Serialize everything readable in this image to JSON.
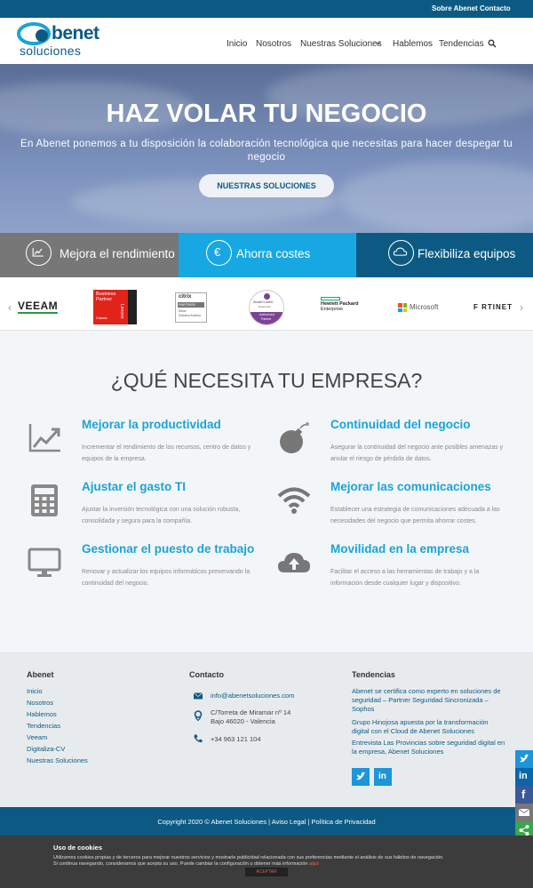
{
  "topbar": {
    "about": "Sobre Abenet",
    "contact": "Contacto"
  },
  "logo": {
    "name": "benet",
    "sub": "soluciones"
  },
  "nav": [
    {
      "label": "Inicio"
    },
    {
      "label": "Nosotros"
    },
    {
      "label": "Nuestras Soluciones"
    },
    {
      "label": "Hablemos"
    },
    {
      "label": "Tendencias"
    }
  ],
  "hero": {
    "title": "HAZ VOLAR TU NEGOCIO",
    "subtitle": "En Abenet ponemos a tu disposición la colaboración tecnológica que necesitas para hacer despegar tu negocio",
    "button": "NUESTRAS SOLUCIONES"
  },
  "features": [
    {
      "label": "Mejora el rendimiento",
      "color": "#777777"
    },
    {
      "label": "Ahorra costes",
      "color": "#17a8e3"
    },
    {
      "label": "Flexibiliza equipos",
      "color": "#0c5a83"
    }
  ],
  "partners": {
    "veeam": "VEEAM",
    "lenovo_line1": "Business",
    "lenovo_line2": "Partner",
    "lenovo_brand": "Lenovo",
    "lenovo_tier": "Classic",
    "citrix": "citrix",
    "citrix_line1": "PARTNER",
    "citrix_line2": "Silver",
    "citrix_line3": "Solution Advisor",
    "alcatel_name": "Alcatel·Lucent",
    "alcatel_sub": "Enterprise",
    "alcatel_tier1": "Authorized",
    "alcatel_tier2": "Partner",
    "hpe_line1": "Hewlett Packard",
    "hpe_line2": "Enterprise",
    "microsoft": "Microsoft",
    "fortinet": "F RTINET"
  },
  "section": {
    "title": "¿QUÉ NECESITA TU EMPRESA?"
  },
  "services": [
    {
      "title": "Mejorar la productividad",
      "text": "Incrementar el rendimiento de los recursos, centro de datos y equipos de la empresa.",
      "icon": "chart-line-icon"
    },
    {
      "title": "Continuidad del negocio",
      "text": "Asegurar la continuidad del negocio ante posibles amenazas y anular el riesgo de pérdida de datos.",
      "icon": "bomb-icon"
    },
    {
      "title": "Ajustar el gasto TI",
      "text": "Ajustar la inversión tecnológica con una solución robusta, consolidada y segura para la compañía.",
      "icon": "calculator-icon"
    },
    {
      "title": "Mejorar las comunicaciones",
      "text": "Establecer una estrategia de comunicaciones adecuada a las necesidades del negocio que permita ahorrar costes.",
      "icon": "wifi-icon"
    },
    {
      "title": "Gestionar el puesto de trabajo",
      "text": "Renovar y actualizar los equipos informáticos preservando la continuidad del negocio.",
      "icon": "monitor-icon"
    },
    {
      "title": "Movilidad en la empresa",
      "text": "Facilitar el acceso a las herramientas de trabajo y a la información desde cualquier lugar y dispositivo.",
      "icon": "cloud-upload-icon"
    }
  ],
  "footer": {
    "col1": {
      "title": "Abenet",
      "links": [
        "Inicio",
        "Nosotros",
        "Hablemos",
        "Tendencias",
        "Veeam",
        "Digitaliza-CV",
        "Nuestras Soluciones"
      ]
    },
    "col2": {
      "title": "Contacto",
      "email": "info@abenetsoluciones.com",
      "address1": "C/Torreta de Miramar nº 14",
      "address2": "Bajo 46020 - Valencia",
      "phone": "+34 963 121 104"
    },
    "col3": {
      "title": "Tendencias",
      "posts": [
        [
          "Abenet se certifica como experto en soluciones de",
          "seguridad – Partner Seguridad Sincronizada –",
          "Sophos"
        ],
        [
          "Grupo Hinojosa apuesta por la transformación",
          "digital con el Cloud de Abenet Soluciones"
        ],
        [
          "Entrevista Las Provincias sobre seguridad digital en",
          "la empresa, Abenet Soluciones"
        ]
      ]
    }
  },
  "copyright": "Copyright 2020 © Abenet Soluciones | Aviso Legal | Política de Privacidad",
  "cookie": {
    "title": "Uso de cookies",
    "line1": "Utilizamos cookies propias y de terceros para mejorar nuestros servicios y mostrarle publicidad relacionada con sus preferencias mediante el análisis de sus hábitos de navegación.",
    "line2": "Si continua navegando, consideramos que acepta su uso. Puede cambiar la configuración u obtener más información",
    "link": "aquí",
    "button": "ACEPTAR"
  },
  "share_colors": [
    "#1d95d9",
    "#0a66a8",
    "#3b5998",
    "#777777",
    "#3aa54a"
  ]
}
